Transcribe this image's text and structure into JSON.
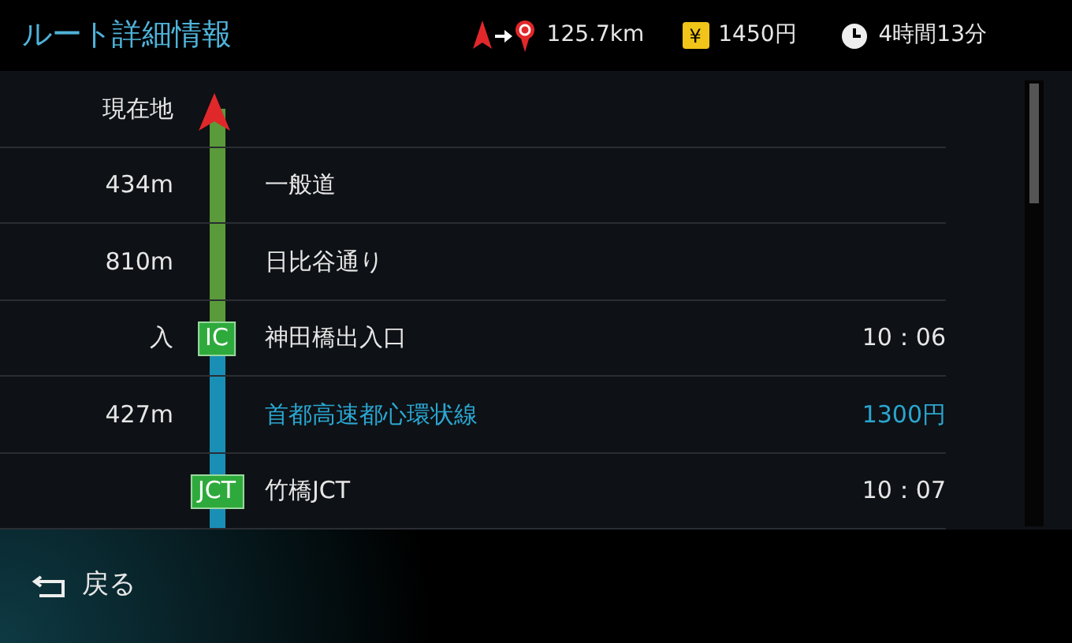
{
  "header": {
    "title": "ルート詳細情報",
    "distance": "125.7km",
    "toll": "1450円",
    "toll_symbol": "¥",
    "duration": "4時間13分"
  },
  "rows": [
    {
      "left": "現在地",
      "current_position": true,
      "expressway": false
    },
    {
      "left": "434m",
      "current_position": false,
      "expressway": false,
      "name": "一般道",
      "highlighted": false
    },
    {
      "left": "810m",
      "current_position": false,
      "expressway": false,
      "name": "日比谷通り",
      "highlighted": false
    },
    {
      "left": "入",
      "current_position": false,
      "badge": "IC",
      "expressway": true,
      "name": "神田橋出入口",
      "right": "10：06",
      "highlighted": false
    },
    {
      "left": "427m",
      "current_position": false,
      "expressway": true,
      "name": "首都高速都心環状線",
      "right": "1300円",
      "highlighted": true
    },
    {
      "current_position": false,
      "badge": "JCT",
      "expressway": true,
      "name": "竹橋JCT",
      "right": "10：07",
      "highlighted": false
    }
  ],
  "footer": {
    "back_label": "戻る"
  }
}
